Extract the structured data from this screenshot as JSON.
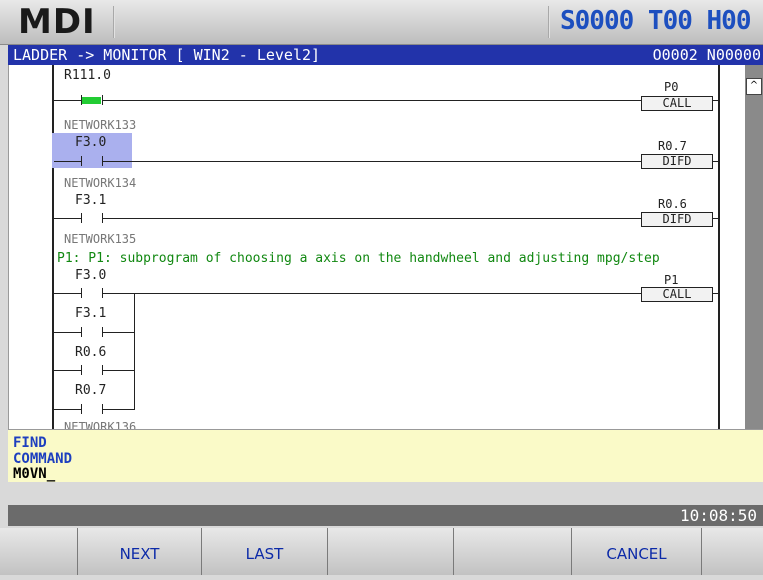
{
  "header": {
    "mode": "MDI",
    "spindle_tool_status": "S0000 T00 H00"
  },
  "titlebar": {
    "left": "LADDER -> MONITOR [ WIN2 - Level2]",
    "right": "O0002 N00000"
  },
  "ladder": {
    "row1": {
      "contact": "R111.0",
      "coil_label": "P0",
      "coil_type": "CALL",
      "contact_state": "active"
    },
    "net133": {
      "network": "NETWORK133",
      "contact": "F3.0",
      "coil_label": "R0.7",
      "coil_type": "DIFD",
      "selected": true
    },
    "net134": {
      "network": "NETWORK134",
      "contact": "F3.1",
      "coil_label": "R0.6",
      "coil_type": "DIFD"
    },
    "net135": {
      "network": "NETWORK135",
      "comment": "P1: P1: subprogram of choosing a axis on the handwheel  and adjusting mpg/step",
      "contacts": [
        "F3.0",
        "F3.1",
        "R0.6",
        "R0.7"
      ],
      "coil_label": "P1",
      "coil_type": "CALL"
    },
    "partial_network": "NETWORK136"
  },
  "command": {
    "line1": "FIND",
    "line2": "COMMAND",
    "input": "M0VN_"
  },
  "status": {
    "time": "10:08:50"
  },
  "softkeys": [
    "",
    "NEXT",
    "LAST",
    "",
    "",
    "CANCEL",
    ""
  ],
  "colors": {
    "title_bg": "#2233aa",
    "active_contact": "#22cc33",
    "selection": "#aab0ee",
    "comment": "#118811",
    "command_bg": "#fafac8",
    "softkey_text": "#0c2aa8"
  }
}
